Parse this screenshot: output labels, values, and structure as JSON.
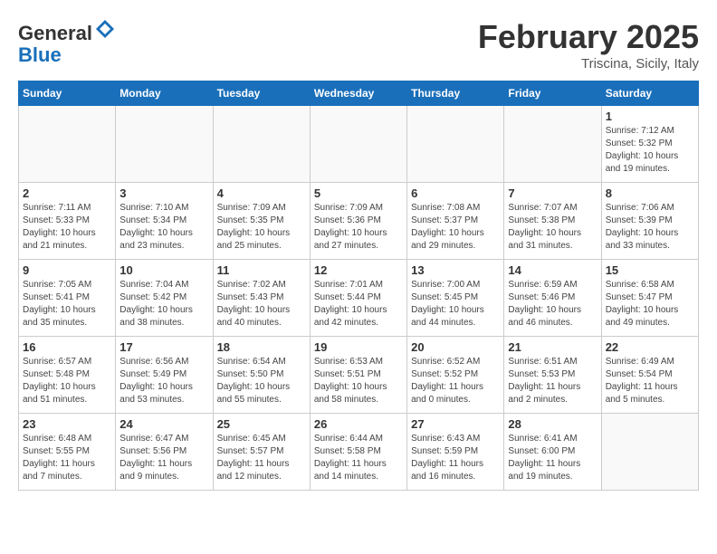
{
  "header": {
    "logo_general": "General",
    "logo_blue": "Blue",
    "month": "February 2025",
    "location": "Triscina, Sicily, Italy"
  },
  "days_of_week": [
    "Sunday",
    "Monday",
    "Tuesday",
    "Wednesday",
    "Thursday",
    "Friday",
    "Saturday"
  ],
  "weeks": [
    [
      {
        "day": "",
        "info": ""
      },
      {
        "day": "",
        "info": ""
      },
      {
        "day": "",
        "info": ""
      },
      {
        "day": "",
        "info": ""
      },
      {
        "day": "",
        "info": ""
      },
      {
        "day": "",
        "info": ""
      },
      {
        "day": "1",
        "info": "Sunrise: 7:12 AM\nSunset: 5:32 PM\nDaylight: 10 hours\nand 19 minutes."
      }
    ],
    [
      {
        "day": "2",
        "info": "Sunrise: 7:11 AM\nSunset: 5:33 PM\nDaylight: 10 hours\nand 21 minutes."
      },
      {
        "day": "3",
        "info": "Sunrise: 7:10 AM\nSunset: 5:34 PM\nDaylight: 10 hours\nand 23 minutes."
      },
      {
        "day": "4",
        "info": "Sunrise: 7:09 AM\nSunset: 5:35 PM\nDaylight: 10 hours\nand 25 minutes."
      },
      {
        "day": "5",
        "info": "Sunrise: 7:09 AM\nSunset: 5:36 PM\nDaylight: 10 hours\nand 27 minutes."
      },
      {
        "day": "6",
        "info": "Sunrise: 7:08 AM\nSunset: 5:37 PM\nDaylight: 10 hours\nand 29 minutes."
      },
      {
        "day": "7",
        "info": "Sunrise: 7:07 AM\nSunset: 5:38 PM\nDaylight: 10 hours\nand 31 minutes."
      },
      {
        "day": "8",
        "info": "Sunrise: 7:06 AM\nSunset: 5:39 PM\nDaylight: 10 hours\nand 33 minutes."
      }
    ],
    [
      {
        "day": "9",
        "info": "Sunrise: 7:05 AM\nSunset: 5:41 PM\nDaylight: 10 hours\nand 35 minutes."
      },
      {
        "day": "10",
        "info": "Sunrise: 7:04 AM\nSunset: 5:42 PM\nDaylight: 10 hours\nand 38 minutes."
      },
      {
        "day": "11",
        "info": "Sunrise: 7:02 AM\nSunset: 5:43 PM\nDaylight: 10 hours\nand 40 minutes."
      },
      {
        "day": "12",
        "info": "Sunrise: 7:01 AM\nSunset: 5:44 PM\nDaylight: 10 hours\nand 42 minutes."
      },
      {
        "day": "13",
        "info": "Sunrise: 7:00 AM\nSunset: 5:45 PM\nDaylight: 10 hours\nand 44 minutes."
      },
      {
        "day": "14",
        "info": "Sunrise: 6:59 AM\nSunset: 5:46 PM\nDaylight: 10 hours\nand 46 minutes."
      },
      {
        "day": "15",
        "info": "Sunrise: 6:58 AM\nSunset: 5:47 PM\nDaylight: 10 hours\nand 49 minutes."
      }
    ],
    [
      {
        "day": "16",
        "info": "Sunrise: 6:57 AM\nSunset: 5:48 PM\nDaylight: 10 hours\nand 51 minutes."
      },
      {
        "day": "17",
        "info": "Sunrise: 6:56 AM\nSunset: 5:49 PM\nDaylight: 10 hours\nand 53 minutes."
      },
      {
        "day": "18",
        "info": "Sunrise: 6:54 AM\nSunset: 5:50 PM\nDaylight: 10 hours\nand 55 minutes."
      },
      {
        "day": "19",
        "info": "Sunrise: 6:53 AM\nSunset: 5:51 PM\nDaylight: 10 hours\nand 58 minutes."
      },
      {
        "day": "20",
        "info": "Sunrise: 6:52 AM\nSunset: 5:52 PM\nDaylight: 11 hours\nand 0 minutes."
      },
      {
        "day": "21",
        "info": "Sunrise: 6:51 AM\nSunset: 5:53 PM\nDaylight: 11 hours\nand 2 minutes."
      },
      {
        "day": "22",
        "info": "Sunrise: 6:49 AM\nSunset: 5:54 PM\nDaylight: 11 hours\nand 5 minutes."
      }
    ],
    [
      {
        "day": "23",
        "info": "Sunrise: 6:48 AM\nSunset: 5:55 PM\nDaylight: 11 hours\nand 7 minutes."
      },
      {
        "day": "24",
        "info": "Sunrise: 6:47 AM\nSunset: 5:56 PM\nDaylight: 11 hours\nand 9 minutes."
      },
      {
        "day": "25",
        "info": "Sunrise: 6:45 AM\nSunset: 5:57 PM\nDaylight: 11 hours\nand 12 minutes."
      },
      {
        "day": "26",
        "info": "Sunrise: 6:44 AM\nSunset: 5:58 PM\nDaylight: 11 hours\nand 14 minutes."
      },
      {
        "day": "27",
        "info": "Sunrise: 6:43 AM\nSunset: 5:59 PM\nDaylight: 11 hours\nand 16 minutes."
      },
      {
        "day": "28",
        "info": "Sunrise: 6:41 AM\nSunset: 6:00 PM\nDaylight: 11 hours\nand 19 minutes."
      },
      {
        "day": "",
        "info": ""
      }
    ]
  ]
}
